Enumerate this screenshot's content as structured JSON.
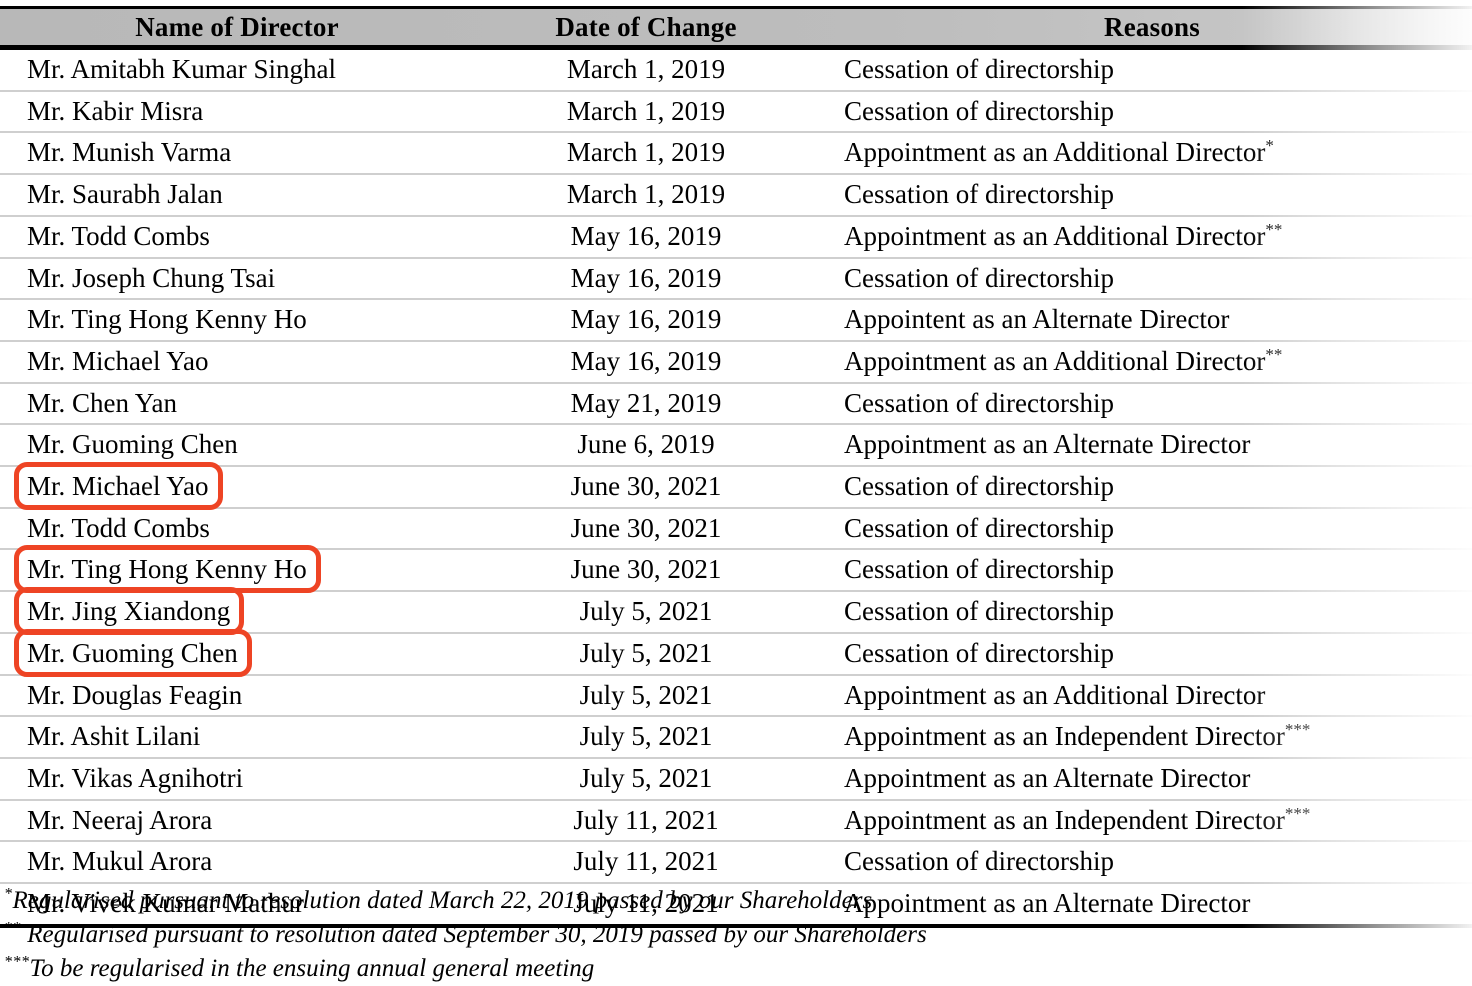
{
  "table": {
    "columns": [
      {
        "key": "name",
        "label": "Name of Director",
        "align": "center"
      },
      {
        "key": "date",
        "label": "Date of Change",
        "align": "center"
      },
      {
        "key": "reason",
        "label": "Reasons",
        "align": "center"
      }
    ],
    "rows": [
      {
        "name": "Mr. Amitabh Kumar Singhal",
        "date": "March 1, 2019",
        "reason": "Cessation of directorship",
        "footnote": "",
        "highlighted": false
      },
      {
        "name": "Mr. Kabir Misra",
        "date": "March 1, 2019",
        "reason": "Cessation of directorship",
        "footnote": "",
        "highlighted": false
      },
      {
        "name": "Mr. Munish Varma",
        "date": "March 1, 2019",
        "reason": "Appointment as an Additional Director",
        "footnote": "*",
        "highlighted": false
      },
      {
        "name": "Mr. Saurabh Jalan",
        "date": "March 1, 2019",
        "reason": "Cessation of directorship",
        "footnote": "",
        "highlighted": false
      },
      {
        "name": "Mr. Todd Combs",
        "date": "May 16, 2019",
        "reason": "Appointment as an Additional Director",
        "footnote": "**",
        "highlighted": false
      },
      {
        "name": "Mr. Joseph Chung Tsai",
        "date": "May 16, 2019",
        "reason": "Cessation of directorship",
        "footnote": "",
        "highlighted": false
      },
      {
        "name": "Mr. Ting Hong Kenny Ho",
        "date": "May 16, 2019",
        "reason": "Appointent as an Alternate Director",
        "footnote": "",
        "highlighted": false
      },
      {
        "name": "Mr. Michael Yao",
        "date": "May 16, 2019",
        "reason": "Appointment as an Additional Director",
        "footnote": "**",
        "highlighted": false
      },
      {
        "name": "Mr. Chen Yan",
        "date": "May 21, 2019",
        "reason": "Cessation of directorship",
        "footnote": "",
        "highlighted": false
      },
      {
        "name": "Mr. Guoming Chen",
        "date": "June 6, 2019",
        "reason": "Appointment as an Alternate Director",
        "footnote": "",
        "highlighted": false
      },
      {
        "name": "Mr. Michael Yao",
        "date": "June 30, 2021",
        "reason": "Cessation of directorship",
        "footnote": "",
        "highlighted": true
      },
      {
        "name": "Mr. Todd Combs",
        "date": "June 30, 2021",
        "reason": "Cessation of directorship",
        "footnote": "",
        "highlighted": false
      },
      {
        "name": "Mr. Ting Hong Kenny Ho",
        "date": "June 30, 2021",
        "reason": "Cessation of directorship",
        "footnote": "",
        "highlighted": true
      },
      {
        "name": "Mr. Jing Xiandong",
        "date": "July 5, 2021",
        "reason": "Cessation of directorship",
        "footnote": "",
        "highlighted": true
      },
      {
        "name": "Mr. Guoming Chen",
        "date": "July 5, 2021",
        "reason": "Cessation of directorship",
        "footnote": "",
        "highlighted": true
      },
      {
        "name": "Mr. Douglas Feagin",
        "date": "July 5, 2021",
        "reason": "Appointment as an Additional Director",
        "footnote": "",
        "highlighted": false
      },
      {
        "name": "Mr. Ashit Lilani",
        "date": "July 5, 2021",
        "reason": "Appointment as an Independent Director",
        "footnote": "***",
        "highlighted": false
      },
      {
        "name": "Mr. Vikas Agnihotri",
        "date": "July 5, 2021",
        "reason": "Appointment as an Alternate Director",
        "footnote": "",
        "highlighted": false
      },
      {
        "name": "Mr. Neeraj Arora",
        "date": "July 11, 2021",
        "reason": "Appointment as an Independent Director",
        "footnote": "***",
        "highlighted": false
      },
      {
        "name": "Mr. Mukul Arora",
        "date": "July 11, 2021",
        "reason": "Cessation of directorship",
        "footnote": "",
        "highlighted": false
      },
      {
        "name": "Mr. Vivek Kumar Mathur",
        "date": "July 11, 2021",
        "reason": "Appointment as an Alternate Director",
        "footnote": "",
        "highlighted": false
      }
    ]
  },
  "footnotes": [
    {
      "mark": "*",
      "text": "Regularised pursuant to resolution dated March 22, 2019 passed by our Shareholders"
    },
    {
      "mark": "**",
      "text": " Regularised pursuant to resolution dated September 30, 2019 passed by our Shareholders"
    },
    {
      "mark": "***",
      "text": "To be regularised in the ensuing annual general meeting"
    }
  ],
  "annotation": {
    "color": "#ee4424",
    "shape": "rounded-rectangle",
    "highlighted_names": [
      "Mr. Michael Yao",
      "Mr. Ting Hong Kenny Ho",
      "Mr. Jing Xiandong",
      "Mr. Guoming Chen"
    ]
  },
  "style": {
    "header_background": "#bcbcbc",
    "row_separator": "#cfcfcf",
    "text_color": "#000000",
    "page_background": "#ffffff"
  }
}
